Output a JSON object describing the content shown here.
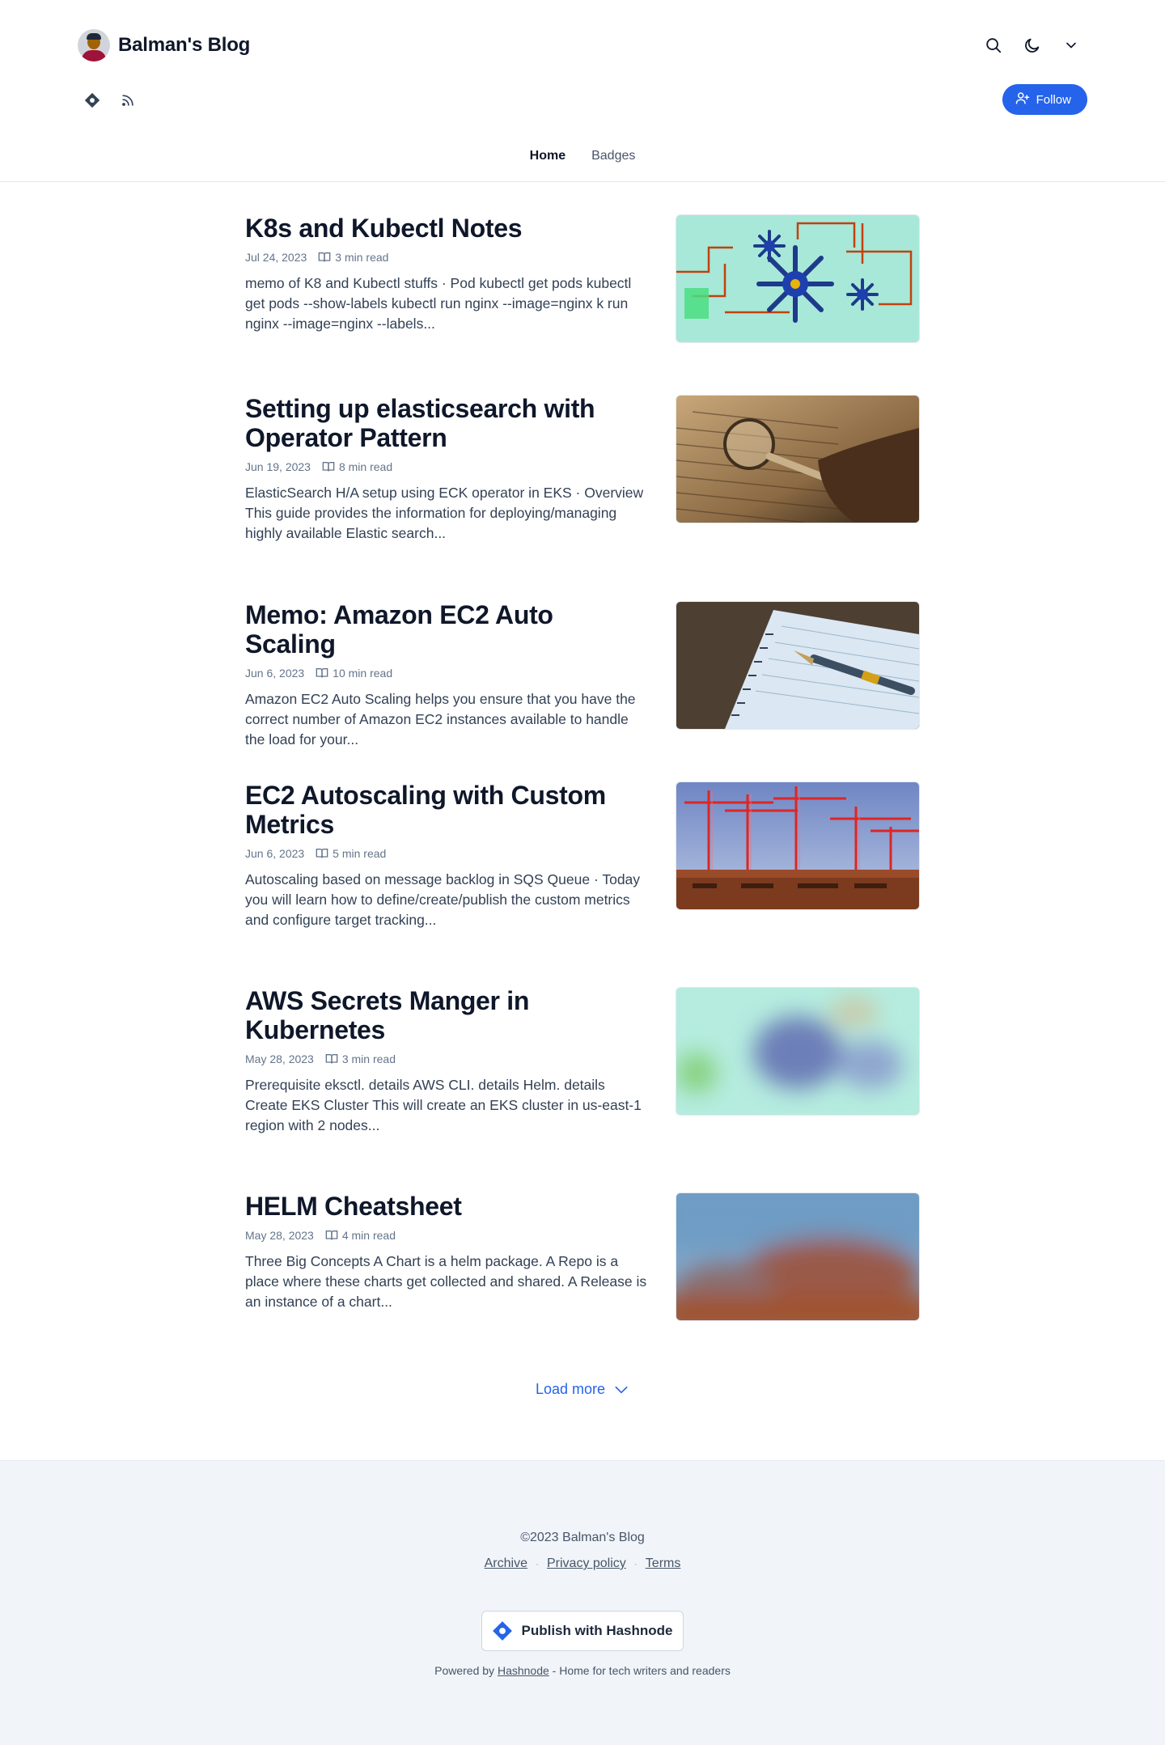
{
  "header": {
    "site_title": "Balman's Blog",
    "icons": [
      "search-icon",
      "moon-icon",
      "chevron-down-icon"
    ],
    "social_icons": [
      "hashnode-icon",
      "rss-icon"
    ],
    "follow_label": "Follow"
  },
  "nav": {
    "tabs": [
      {
        "label": "Home",
        "active": true
      },
      {
        "label": "Badges",
        "active": false
      }
    ]
  },
  "posts": [
    {
      "title": "K8s and Kubectl Notes",
      "date": "Jul 24, 2023",
      "read_time": "3 min read",
      "excerpt": "memo of K8 and Kubectl stuffs · Pod kubectl get pods kubectl get pods --show-labels kubectl run nginx --image=nginx k run nginx --image=nginx --labels...",
      "thumbnail": "gears-illustration"
    },
    {
      "title": "Setting up elasticsearch with Operator Pattern",
      "date": "Jun 19, 2023",
      "read_time": "8 min read",
      "excerpt": "ElasticSearch H/A setup using ECK operator in EKS · Overview This guide provides the information for deploying/managing highly available Elastic search...",
      "thumbnail": "magnifying-glass-photo"
    },
    {
      "title": "Memo: Amazon EC2 Auto Scaling",
      "date": "Jun 6, 2023",
      "read_time": "10 min read",
      "excerpt": "Amazon EC2 Auto Scaling helps you ensure that you have the correct number of Amazon EC2 instances available to handle the load for your...",
      "thumbnail": "notebook-pen-photo"
    },
    {
      "title": "EC2 Autoscaling with Custom Metrics",
      "date": "Jun 6, 2023",
      "read_time": "5 min read",
      "excerpt": "Autoscaling based on message backlog in SQS Queue · Today you will learn how to define/create/publish the custom metrics and configure target tracking...",
      "thumbnail": "cranes-photo"
    },
    {
      "title": "AWS Secrets Manger in Kubernetes",
      "date": "May 28, 2023",
      "read_time": "3 min read",
      "excerpt": "Prerequisite eksctl. details AWS CLI. details Helm. details Create EKS Cluster This will create an EKS cluster in us-east-1 region with 2 nodes...",
      "thumbnail": "blurred-gears"
    },
    {
      "title": "HELM Cheatsheet",
      "date": "May 28, 2023",
      "read_time": "4 min read",
      "excerpt": "Three Big Concepts A Chart is a helm package. A Repo is a place where these charts get collected and shared. A Release is an instance of a chart...",
      "thumbnail": "blurred-cranes"
    }
  ],
  "load_more_label": "Load more",
  "footer": {
    "copyright": "©2023 Balman's Blog",
    "links": [
      "Archive",
      "Privacy policy",
      "Terms"
    ],
    "publish_label": "Publish with Hashnode",
    "powered_prefix": "Powered by",
    "powered_link": "Hashnode",
    "powered_suffix": "- Home for tech writers and readers"
  },
  "colors": {
    "accent": "#2563eb",
    "text": "#0f172a",
    "muted": "#64748b",
    "footer_bg": "#f1f5f9"
  }
}
